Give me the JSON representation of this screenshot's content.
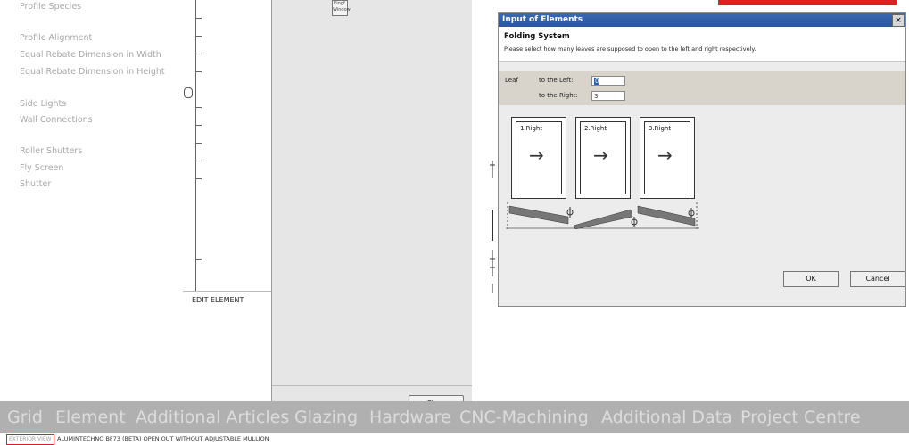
{
  "sidebar": {
    "items": [
      {
        "label": "Profile Species"
      },
      {
        "label": "Profile Alignment"
      },
      {
        "label": "Equal Rebate Dimension in Width"
      },
      {
        "label": "Equal Rebate Dimension in Height"
      },
      {
        "label": "Side Lights"
      },
      {
        "label": "Wall Connections"
      },
      {
        "label": "Roller Shutters"
      },
      {
        "label": "Fly Screen"
      },
      {
        "label": "Shutter"
      }
    ]
  },
  "edit_panel": {
    "label": "EDIT ELEMENT"
  },
  "gray_dialog": {
    "icon_text": "Eingf. Window",
    "close_label": "Close"
  },
  "dialog": {
    "title": "Input of Elements",
    "close_glyph": "×",
    "heading": "Folding System",
    "description": "Please select how many leaves are supposed to open to the left and right respectively.",
    "leaf_label": "Leaf",
    "left_label": "to the Left:",
    "left_value": "0",
    "right_label": "to the Right:",
    "right_value": "3",
    "leaves": [
      {
        "label": "1.Right",
        "arrow": "→"
      },
      {
        "label": "2.Right",
        "arrow": "→"
      },
      {
        "label": "3.Right",
        "arrow": "→"
      }
    ],
    "ok_label": "OK",
    "cancel_label": "Cancel"
  },
  "bottom_nav": {
    "items": [
      {
        "label": "Grid"
      },
      {
        "label": "Element"
      },
      {
        "label": "Additional Articles"
      },
      {
        "label": "Glazing"
      },
      {
        "label": "Hardware"
      },
      {
        "label": "CNC-Machining"
      },
      {
        "label": "Additional Data"
      },
      {
        "label": "Project Centre"
      }
    ]
  },
  "status": {
    "view_badge": "EXTERIOR VIEW",
    "text": "ALUMINTECHNO BF73 (BETA) OPEN OUT WITHOUT ADJUSTABLE MULLION"
  },
  "colors": {
    "accent_red": "#e02020",
    "title_blue": "#2a56a0"
  }
}
